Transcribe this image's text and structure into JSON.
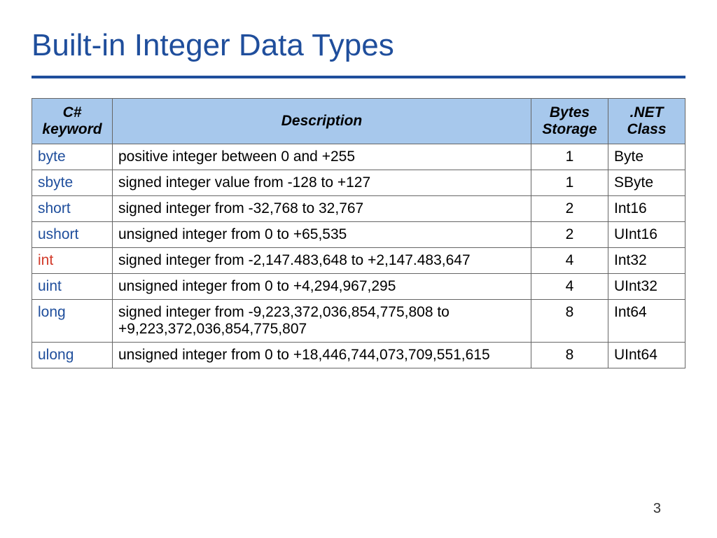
{
  "title": "Built-in Integer Data Types",
  "page_number": "3",
  "table": {
    "headers": {
      "keyword": "C# keyword",
      "description": "Description",
      "bytes": "Bytes Storage",
      "class": ".NET Class"
    },
    "rows": [
      {
        "keyword": "byte",
        "hot": false,
        "description": "positive integer between 0 and +255",
        "bytes": "1",
        "class": "Byte"
      },
      {
        "keyword": "sbyte",
        "hot": false,
        "description": "signed integer value from -128 to +127",
        "bytes": "1",
        "class": "SByte"
      },
      {
        "keyword": "short",
        "hot": false,
        "description": "signed integer from -32,768 to 32,767",
        "bytes": "2",
        "class": "Int16"
      },
      {
        "keyword": "ushort",
        "hot": false,
        "description": "unsigned integer from 0 to +65,535",
        "bytes": "2",
        "class": "UInt16"
      },
      {
        "keyword": "int",
        "hot": true,
        "description": "signed integer from -2,147.483,648 to +2,147.483,647",
        "bytes": "4",
        "class": "Int32"
      },
      {
        "keyword": "uint",
        "hot": false,
        "description": "unsigned integer from 0 to +4,294,967,295",
        "bytes": "4",
        "class": "UInt32"
      },
      {
        "keyword": "long",
        "hot": false,
        "description": "signed integer from -9,223,372,036,854,775,808 to +9,223,372,036,854,775,807",
        "bytes": "8",
        "class": "Int64"
      },
      {
        "keyword": "ulong",
        "hot": false,
        "description": "unsigned integer from 0 to +18,446,744,073,709,551,615",
        "bytes": "8",
        "class": "UInt64"
      }
    ]
  }
}
